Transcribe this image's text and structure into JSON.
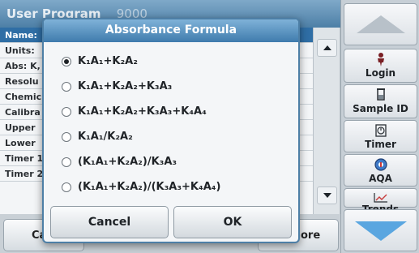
{
  "app_header": {
    "title_part1": "User ",
    "title_part2": "Program",
    "number": "9000"
  },
  "parameters": [
    {
      "label": "Name:",
      "selected": true
    },
    {
      "label": "Units: ",
      "selected": false
    },
    {
      "label": "Abs: K,",
      "selected": false
    },
    {
      "label": "Resolu",
      "selected": false
    },
    {
      "label": "Chemic",
      "selected": false
    },
    {
      "label": "Calibra",
      "selected": false
    },
    {
      "label": "Upper",
      "selected": false
    },
    {
      "label": "Lower",
      "selected": false
    },
    {
      "label": "Timer 1",
      "selected": false
    },
    {
      "label": "Timer 2",
      "selected": false
    }
  ],
  "bottom_bar": {
    "left_label": "Ca",
    "right_label": "ore"
  },
  "side_panel": {
    "login": "Login",
    "sample_id": "Sample ID",
    "timer": "Timer",
    "aqa": "AQA",
    "trends": "Trends"
  },
  "dialog": {
    "title": "Absorbance Formula",
    "options": [
      {
        "label": "K₁A₁+K₂A₂",
        "checked": true
      },
      {
        "label": "K₁A₁+K₂A₂+K₃A₃",
        "checked": false
      },
      {
        "label": "K₁A₁+K₂A₂+K₃A₃+K₄A₄",
        "checked": false
      },
      {
        "label": "K₁A₁/K₂A₂",
        "checked": false
      },
      {
        "label": "(K₁A₁+K₂A₂)/K₃A₃",
        "checked": false
      },
      {
        "label": "(K₁A₁+K₂A₂)/(K₃A₃+K₄A₄)",
        "checked": false
      }
    ],
    "cancel": "Cancel",
    "ok": "OK"
  },
  "colors": {
    "header_blue": "#4d7fa6",
    "selected_row": "#2f6ea5",
    "accent_arrow": "#5aa6e0"
  }
}
